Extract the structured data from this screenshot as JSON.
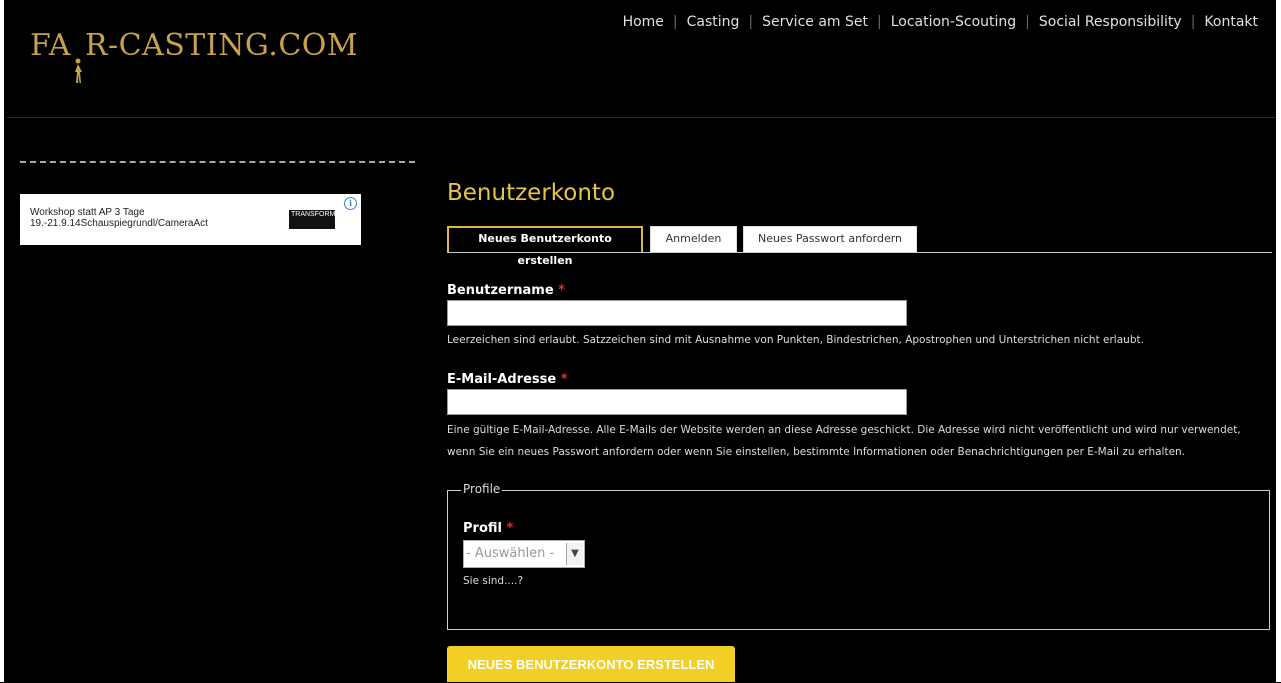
{
  "logo": {
    "text_left": "FA",
    "text_right": "R-CASTING.COM"
  },
  "nav": [
    {
      "label": "Home"
    },
    {
      "label": "Casting"
    },
    {
      "label": "Service am Set"
    },
    {
      "label": "Location-Scouting"
    },
    {
      "label": "Social Responsibility"
    },
    {
      "label": "Kontakt"
    }
  ],
  "ad": {
    "line1": "Workshop statt AP 3 Tage",
    "line2": "19.-21.9.14Schauspiegrundl/CameraAct",
    "badge_text": "TRANSFORM"
  },
  "page": {
    "title": "Benutzerkonto"
  },
  "tabs": [
    {
      "label": "Neues Benutzerkonto erstellen",
      "active": true
    },
    {
      "label": "Anmelden",
      "active": false
    },
    {
      "label": "Neues Passwort anfordern",
      "active": false
    }
  ],
  "form": {
    "username": {
      "label": "Benutzername",
      "required_mark": "*",
      "value": "",
      "description": "Leerzeichen sind erlaubt. Satzzeichen sind mit Ausnahme von Punkten, Bindestrichen, Apostrophen und Unterstrichen nicht erlaubt."
    },
    "email": {
      "label": "E-Mail-Adresse",
      "required_mark": "*",
      "value": "",
      "description_line1": "Eine gültige E-Mail-Adresse. Alle E-Mails der Website werden an diese Adresse geschickt. Die Adresse wird nicht veröffentlicht und wird nur verwendet,",
      "description_line2": "wenn Sie ein neues Passwort anfordern oder wenn Sie einstellen, bestimmte Informationen oder Benachrichtigungen per E-Mail zu erhalten."
    },
    "profile_fieldset": {
      "legend": "Profile",
      "label": "Profil",
      "required_mark": "*",
      "selected": "- Auswählen -",
      "description": "Sie sind....?"
    },
    "submit_label": "NEUES BENUTZERKONTO ERSTELLEN"
  },
  "colors": {
    "accent": "#e4c449",
    "logo": "#c8a24a",
    "button": "#f2cf25",
    "required": "#e03030"
  }
}
